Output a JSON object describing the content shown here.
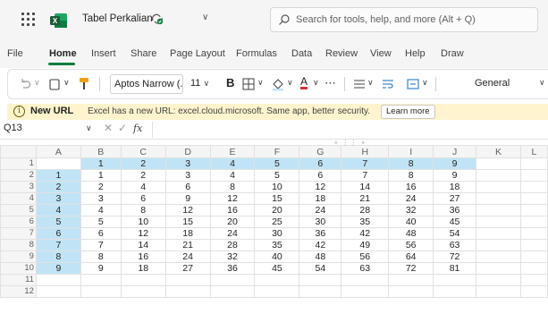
{
  "titlebar": {
    "app_logo_text": "X",
    "doc_title": "Tabel Perkalian",
    "search_placeholder": "Search for tools, help, and more (Alt + Q)"
  },
  "menu": {
    "tabs": [
      "File",
      "Home",
      "Insert",
      "Share",
      "Page Layout",
      "Formulas",
      "Data",
      "Review",
      "View",
      "Help",
      "Draw"
    ],
    "active": "Home"
  },
  "ribbon": {
    "font_name": "Aptos Narrow (...",
    "font_size": "11",
    "number_format": "General",
    "bold_label": "B",
    "font_color_label": "A",
    "more_label": "⋯"
  },
  "message": {
    "title": "New URL",
    "text": "Excel has a new URL: excel.cloud.microsoft. Same app, better security.",
    "button": "Learn more"
  },
  "formula_bar": {
    "cell_ref": "Q13",
    "fx_label": "fx",
    "formula": ""
  },
  "sheet": {
    "columns": [
      "A",
      "B",
      "C",
      "D",
      "E",
      "F",
      "G",
      "H",
      "I",
      "J",
      "K",
      "L"
    ],
    "rows": [
      [
        "",
        "1",
        "2",
        "3",
        "4",
        "5",
        "6",
        "7",
        "8",
        "9",
        "",
        ""
      ],
      [
        "1",
        "1",
        "2",
        "3",
        "4",
        "5",
        "6",
        "7",
        "8",
        "9",
        "",
        ""
      ],
      [
        "2",
        "2",
        "4",
        "6",
        "8",
        "10",
        "12",
        "14",
        "16",
        "18",
        "",
        ""
      ],
      [
        "3",
        "3",
        "6",
        "9",
        "12",
        "15",
        "18",
        "21",
        "24",
        "27",
        "",
        ""
      ],
      [
        "4",
        "4",
        "8",
        "12",
        "16",
        "20",
        "24",
        "28",
        "32",
        "36",
        "",
        ""
      ],
      [
        "5",
        "5",
        "10",
        "15",
        "20",
        "25",
        "30",
        "35",
        "40",
        "45",
        "",
        ""
      ],
      [
        "6",
        "6",
        "12",
        "18",
        "24",
        "30",
        "36",
        "42",
        "48",
        "54",
        "",
        ""
      ],
      [
        "7",
        "7",
        "14",
        "21",
        "28",
        "35",
        "42",
        "49",
        "56",
        "63",
        "",
        ""
      ],
      [
        "8",
        "8",
        "16",
        "24",
        "32",
        "40",
        "48",
        "56",
        "64",
        "72",
        "",
        ""
      ],
      [
        "9",
        "9",
        "18",
        "27",
        "36",
        "45",
        "54",
        "63",
        "72",
        "81",
        "",
        ""
      ],
      [
        "",
        "",
        "",
        "",
        "",
        "",
        "",
        "",
        "",
        "",
        "",
        ""
      ],
      [
        "",
        "",
        "",
        "",
        "",
        "",
        "",
        "",
        "",
        "",
        "",
        ""
      ]
    ],
    "row_numbers": [
      "1",
      "2",
      "3",
      "4",
      "5",
      "6",
      "7",
      "8",
      "9",
      "10",
      "11",
      "12"
    ],
    "highlight_color": "#c0e4f5"
  },
  "colors": {
    "accent": "#107c41",
    "message_bg": "#fff4ce"
  }
}
